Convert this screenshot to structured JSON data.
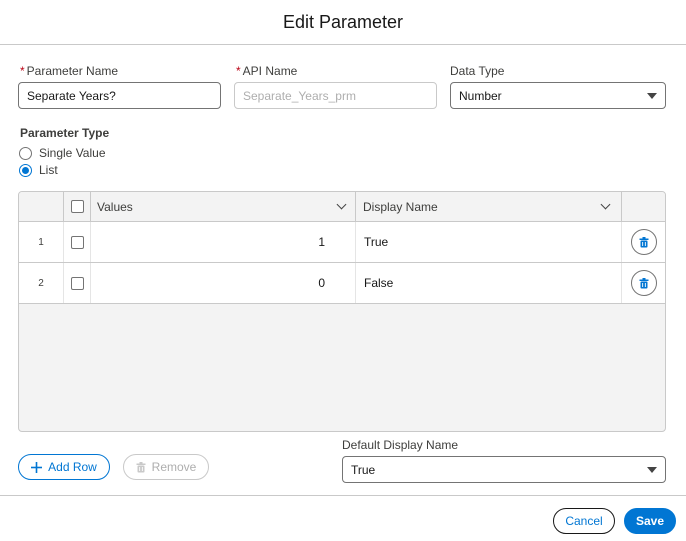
{
  "modal": {
    "title": "Edit Parameter"
  },
  "fields": {
    "parameter_name": {
      "label": "Parameter Name",
      "required_mark": "*",
      "value": "Separate Years?"
    },
    "api_name": {
      "label": "API Name",
      "required_mark": "*",
      "placeholder": "Separate_Years_prm"
    },
    "data_type": {
      "label": "Data Type",
      "value": "Number"
    }
  },
  "parameter_type": {
    "title": "Parameter Type",
    "options": [
      {
        "label": "Single Value",
        "checked": false
      },
      {
        "label": "List",
        "checked": true
      }
    ]
  },
  "grid": {
    "columns": {
      "values": "Values",
      "display_name": "Display Name"
    },
    "rows": [
      {
        "num": "1",
        "value": "1",
        "display": "True"
      },
      {
        "num": "2",
        "value": "0",
        "display": "False"
      }
    ]
  },
  "actions": {
    "add_row": "Add Row",
    "remove": "Remove"
  },
  "default_display": {
    "label": "Default Display Name",
    "value": "True"
  },
  "footer": {
    "cancel": "Cancel",
    "save": "Save"
  },
  "colors": {
    "brand": "#0176d3",
    "required": "#ba0517",
    "border": "#c9c9c9"
  },
  "icons": [
    "chevron-down-icon",
    "trash-icon",
    "plus-icon",
    "caret-down-icon"
  ]
}
